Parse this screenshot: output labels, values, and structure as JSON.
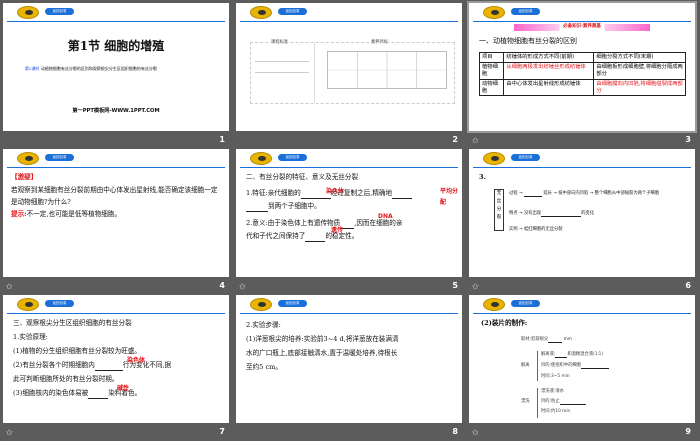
{
  "common": {
    "back_button": "返回目录"
  },
  "slides": [
    {
      "number": "1",
      "title": "第1节 细胞的增殖",
      "lesson_tag": "第2课时",
      "subtitle": "动植物细胞有丝分裂的区别和观察根尖分生区组织细胞的有丝分裂",
      "footer": "第一PPT模板网-WWW.1PPT.COM"
    },
    {
      "number": "2",
      "col1": "课程标准",
      "col2": "素养目标"
    },
    {
      "number": "3",
      "banner": "必备知识·素养奠基",
      "heading": "一、动植物细胞有丝分裂的区别",
      "table": {
        "h0": "项目",
        "h1": "纺锤体的形成方式不同(前期)",
        "h2": "细胞分裂方式不同(末期)",
        "r1": "植物细胞",
        "r1a": "从细胞两极发出纺锤丝形成纺锤体",
        "r1b": "由细胞板形成细胞壁,将细胞分隔成两部分",
        "r2": "动物细胞",
        "r2a": "由中心体发出星射线形成纺锤体",
        "r2b": "由细胞膜向内凹陷,将细胞缢裂成两部分"
      }
    },
    {
      "number": "4",
      "tag": "【激疑】",
      "q": "若观察到某细胞有丝分裂前期由中心体发出星射线,能否确定该细胞一定是动物细胞?为什么?",
      "hint_label": "提示:",
      "hint": "不一定,也可能是低等植物细胞。"
    },
    {
      "number": "5",
      "heading": "二、有丝分裂的特征、意义及无丝分裂",
      "l1a": "1.特征:亲代细胞的",
      "l1b": "经过复制之后,精确地",
      "l1c": "到两个子细胞中。",
      "a1": "染色体",
      "a2": "平均分配",
      "l2a": "2.意义:由于染色体上有遗传物质",
      "l2b": ",因而在细胞的亲",
      "l2c": "代和子代之间保持了",
      "l2d": "的稳定性。",
      "a3": "DNA",
      "a4": "遗传"
    },
    {
      "number": "6",
      "heading": "3.",
      "root": "无丝分裂",
      "b1": "过程",
      "b2": "特点",
      "b3": "实例",
      "p1": "延长",
      "p2": "核中部向内凹陷",
      "p3": "整个细胞从中部缢裂为两个子细胞",
      "f1": "没有出现",
      "f2": "的变化",
      "e1": "蛙红细胞的无丝分裂"
    },
    {
      "number": "7",
      "heading": "三、观察根尖分生区组织细胞的有丝分裂",
      "l1": "1.实验原理:",
      "l2": "(1)植物的分生组织细胞有丝分裂较为旺盛。",
      "l3a": "(2)有丝分裂各个时期细胞内",
      "l3b": "行为变化不同,据",
      "l4": "此可判断细胞所处的有丝分裂时期。",
      "l5a": "(3)细胞核内的染色体易被",
      "l5b": "染料着色。",
      "a1": "染色体",
      "a2": "碱性"
    },
    {
      "number": "8",
      "l1": "2.实验步骤:",
      "l2": "(1)洋葱根尖的培养:实验前3~4 d,将洋葱放在装满清",
      "l3": "水的广口瓶上,底部接触清水,置于温暖处培养,待根长",
      "l4": "至约5 cm。"
    },
    {
      "number": "9",
      "heading": "(2)装片的制作:",
      "s1": "取材:剪取根尖",
      "s1b": "mm",
      "s2": "解离",
      "s2a": "解离液:",
      "s2b": "和酒精混合液(1∶1)",
      "s2c": "目的:使组织中的细胞",
      "s2d": "时间:3~5 min",
      "s3": "漂洗",
      "s3a": "漂洗液:清水",
      "s3b": "目的:防止",
      "s3c": "时间:约10 min"
    }
  ]
}
